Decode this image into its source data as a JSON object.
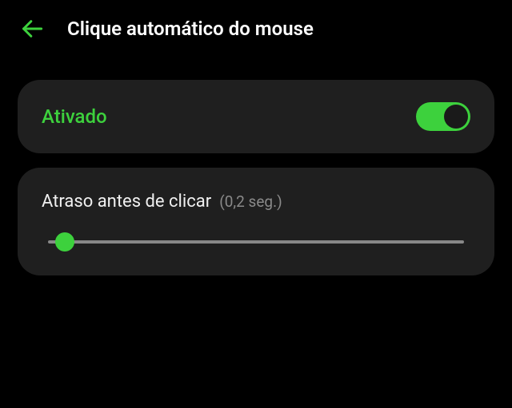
{
  "header": {
    "title": "Clique automático do mouse"
  },
  "toggle": {
    "label": "Ativado",
    "enabled": true
  },
  "slider": {
    "label": "Atraso antes de clicar",
    "value_text": "(0,2 seg.)",
    "value": 0.2,
    "position_percent": 4
  },
  "colors": {
    "accent": "#3dd13d",
    "background": "#000000",
    "card": "#1f1f1f"
  }
}
